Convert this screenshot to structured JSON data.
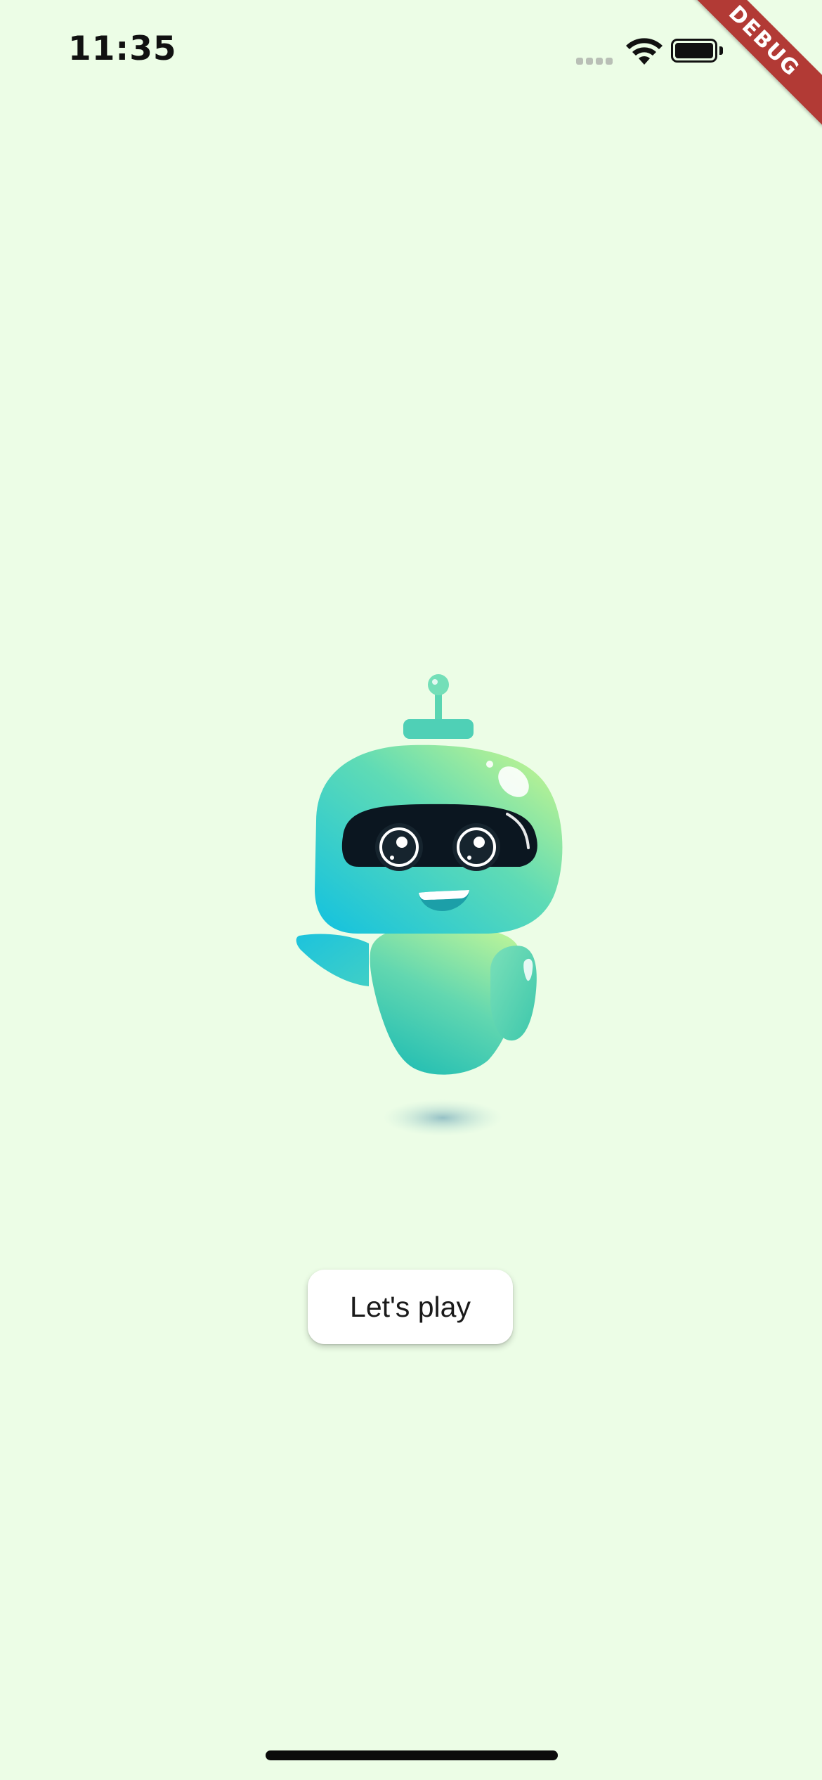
{
  "status_bar": {
    "time": "11:35"
  },
  "debug_banner": {
    "label": "DEBUG"
  },
  "main": {
    "illustration_icon": "robot-mascot-illustration",
    "play_button_label": "Let's play"
  },
  "colors": {
    "background": "#ecfde6",
    "debug_ribbon": "#b23a35",
    "button_background": "#ffffff",
    "robot_green": "#6fdcb0",
    "robot_cyan": "#16c4dc",
    "robot_lime": "#c8f58a",
    "visor": "#0b1620"
  }
}
